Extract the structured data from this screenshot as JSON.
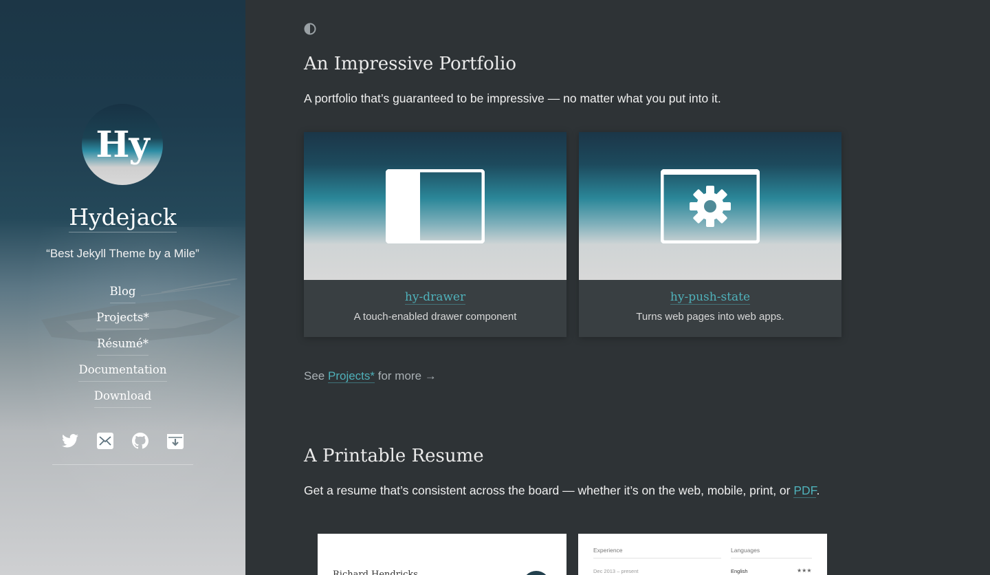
{
  "sidebar": {
    "avatar_text": "Hy",
    "title": "Hydejack",
    "tagline": "“Best Jekyll Theme by a Mile”",
    "nav": [
      {
        "label": "Blog"
      },
      {
        "label": "Projects*"
      },
      {
        "label": "Résumé*"
      },
      {
        "label": "Documentation"
      },
      {
        "label": "Download"
      }
    ],
    "social_icons": [
      "twitter-icon",
      "email-icon",
      "github-icon",
      "download-icon"
    ]
  },
  "main": {
    "theme_toggle_icon": "half-circle-icon",
    "portfolio": {
      "heading": "An Impressive Portfolio",
      "lead": "A portfolio that’s guaranteed to be impressive — no matter what you put into it.",
      "cards": [
        {
          "title": "hy-drawer",
          "description": "A touch-enabled drawer component",
          "icon": "drawer-icon"
        },
        {
          "title": "hy-push-state",
          "description": "Turns web pages into web apps.",
          "icon": "gear-window-icon"
        }
      ],
      "see_more_prefix": "See",
      "see_more_link": "Projects*",
      "see_more_suffix": "for more",
      "see_more_arrow": "→"
    },
    "resume": {
      "heading": "A Printable Resume",
      "lead_prefix": "Get a resume that’s consistent across the board — whether it’s on the web, mobile, print, or",
      "lead_link": "PDF",
      "lead_suffix": ".",
      "preview_a": {
        "name": "Richard Hendricks"
      },
      "preview_b": {
        "experience_label": "Experience",
        "languages_label": "Languages",
        "date": "Dec 2013 – present",
        "language": "English",
        "rating": "★★★"
      }
    }
  },
  "colors": {
    "background": "#2e3336",
    "accent": "#4fb1ba",
    "card": "#393f42"
  }
}
